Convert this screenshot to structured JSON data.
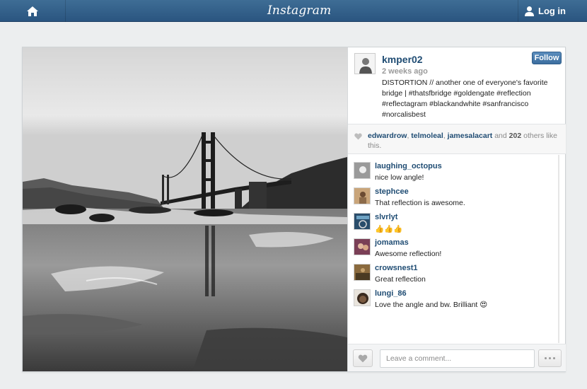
{
  "topbar": {
    "logo": "Instagram",
    "home_icon": "home-icon",
    "login_icon": "user-icon",
    "login_label": "Log in",
    "bar_color": "#2f5c86"
  },
  "post": {
    "username": "kmper02",
    "follow_label": "Follow",
    "time": "2 weeks ago",
    "caption": "DISTORTION // another one of everyone's favorite bridge | #thatsfbridge #goldengate #reflection #reflectagram #blackandwhite #sanfrancisco #norcalisbest",
    "photo_icon": "golden-gate-bridge-photo"
  },
  "likes": {
    "heart_icon": "heart-icon",
    "likers": [
      "edwardrow",
      "telmoleal",
      "jamesalacart"
    ],
    "and_text": " and ",
    "count": "202",
    "others_text": " others like this."
  },
  "comments": [
    {
      "user": "laughing_octopus",
      "text": "nice low angle!"
    },
    {
      "user": "stephcee",
      "text": "That reflection is awesome."
    },
    {
      "user": "slvrlyt",
      "text": "👍👍👍"
    },
    {
      "user": "jomamas",
      "text": "Awesome reflection!"
    },
    {
      "user": "crowsnest1",
      "text": "Great reflection"
    },
    {
      "user": "lungi_86",
      "text": "Love the angle and bw. Brilliant 😍"
    }
  ],
  "footer": {
    "like_icon": "heart-icon",
    "comment_placeholder": "Leave a comment...",
    "more_icon": "ellipsis-icon"
  }
}
